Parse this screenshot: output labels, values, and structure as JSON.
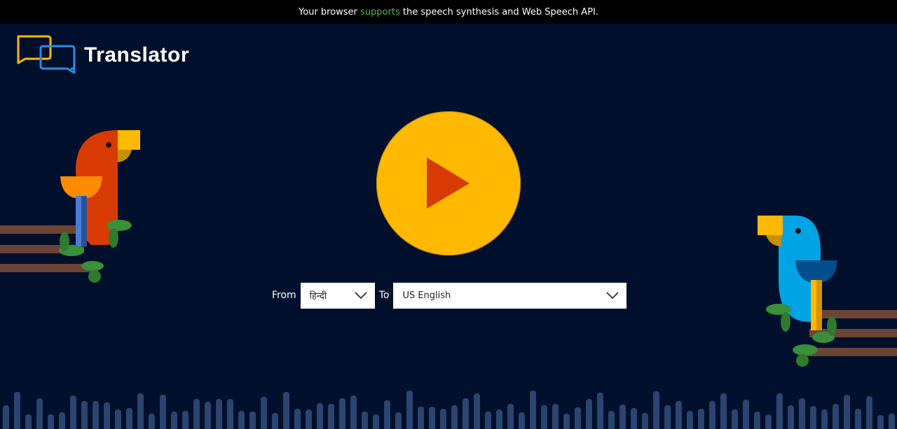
{
  "banner": {
    "prefix": "Your browser",
    "status": "supports",
    "suffix": "the speech synthesis and Web Speech API."
  },
  "app": {
    "title": "Translator"
  },
  "controls": {
    "from_label": "From",
    "from_value": "हिन्दी",
    "to_label": "To",
    "to_value": "US English"
  },
  "icons": {
    "logo": "chat-bubbles-icon",
    "play": "play-icon",
    "dropdown": "chevron-down-icon"
  },
  "colors": {
    "background": "#000f2b",
    "accent": "#ffb900",
    "play_triangle": "#d83b01",
    "supported": "#57b35a"
  }
}
